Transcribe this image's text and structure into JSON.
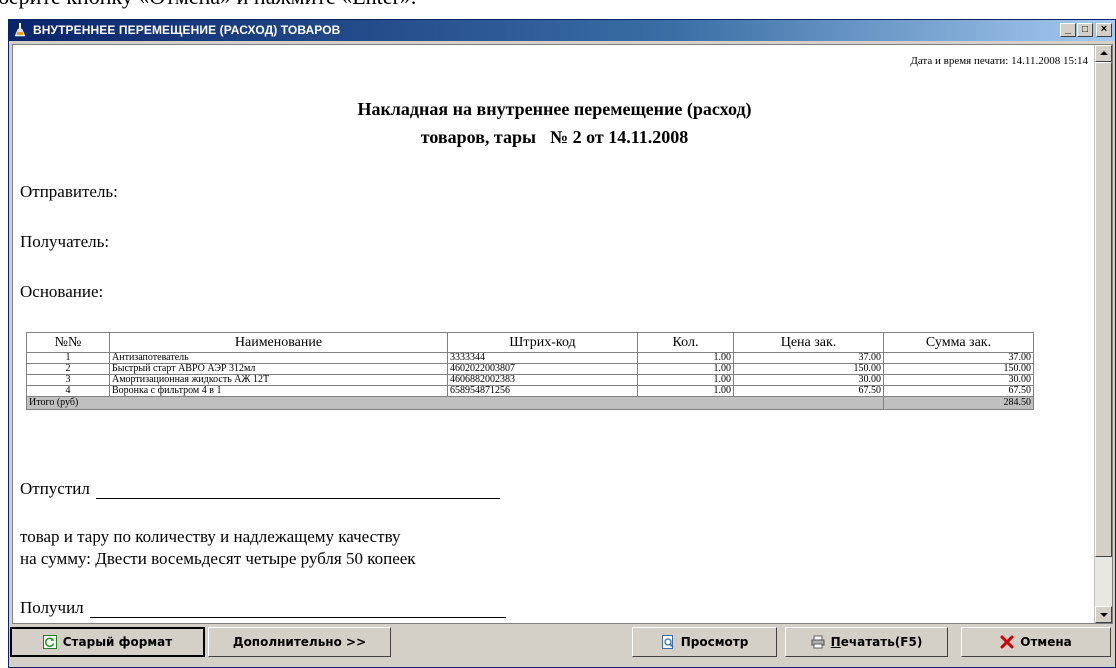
{
  "background_text": "берите кнопку «Отмена» и нажмите «Enter».",
  "window": {
    "title": "ВНУТРЕННЕЕ ПЕРЕМЕЩЕНИЕ (РАСХОД) ТОВАРОВ",
    "controls": {
      "minimize": "_",
      "maximize": "□",
      "close": "×"
    }
  },
  "document": {
    "print_datetime": "Дата и время печати: 14.11.2008 15:14",
    "title_line1": "Накладная на внутреннее перемещение (расход)",
    "title_line2": "товаров, тары",
    "number": "№ 2 от  14.11.2008",
    "sender_label": "Отправитель:",
    "recipient_label": "Получатель:",
    "basis_label": "Основание:",
    "table": {
      "headers": [
        "№№",
        "Наименование",
        "Штрих-код",
        "Кол.",
        "Цена зак.",
        "Сумма зак."
      ],
      "rows": [
        [
          "1",
          "Антизапотеватель",
          "3333344",
          "1.00",
          "37.00",
          "37.00"
        ],
        [
          "2",
          "Быстрый старт АВРО АЭР 312мл",
          "4602022003807",
          "1.00",
          "150.00",
          "150.00"
        ],
        [
          "3",
          "Амортизационная жидкость АЖ 12Т",
          "4606882002383",
          "1.00",
          "30.00",
          "30.00"
        ],
        [
          "4",
          "Воронка с фильтром 4 в 1",
          "658954871256",
          "1.00",
          "67.50",
          "67.50"
        ]
      ],
      "total_label": "Итого (руб)",
      "total_value": "284.50"
    },
    "released_label": "Отпустил",
    "note_line1": "товар и тару по количеству и надлежащему качеству",
    "note_line2": "на сумму: Двести восемьдесят четыре рубля 50 копеек",
    "received_label": "Получил"
  },
  "buttons": {
    "old_format": "Старый формат",
    "more": "Дополнительно >>",
    "preview": "Просмотр",
    "print_prefix": "П",
    "print_rest": "ечатать(F5)",
    "cancel": "Отмена"
  },
  "colors": {
    "titlebar": "#0a246a",
    "titlebar_end": "#a6caf0",
    "face": "#d4d0c8",
    "total_row": "#c0c0c0",
    "cancel_icon": "#cc0000"
  }
}
